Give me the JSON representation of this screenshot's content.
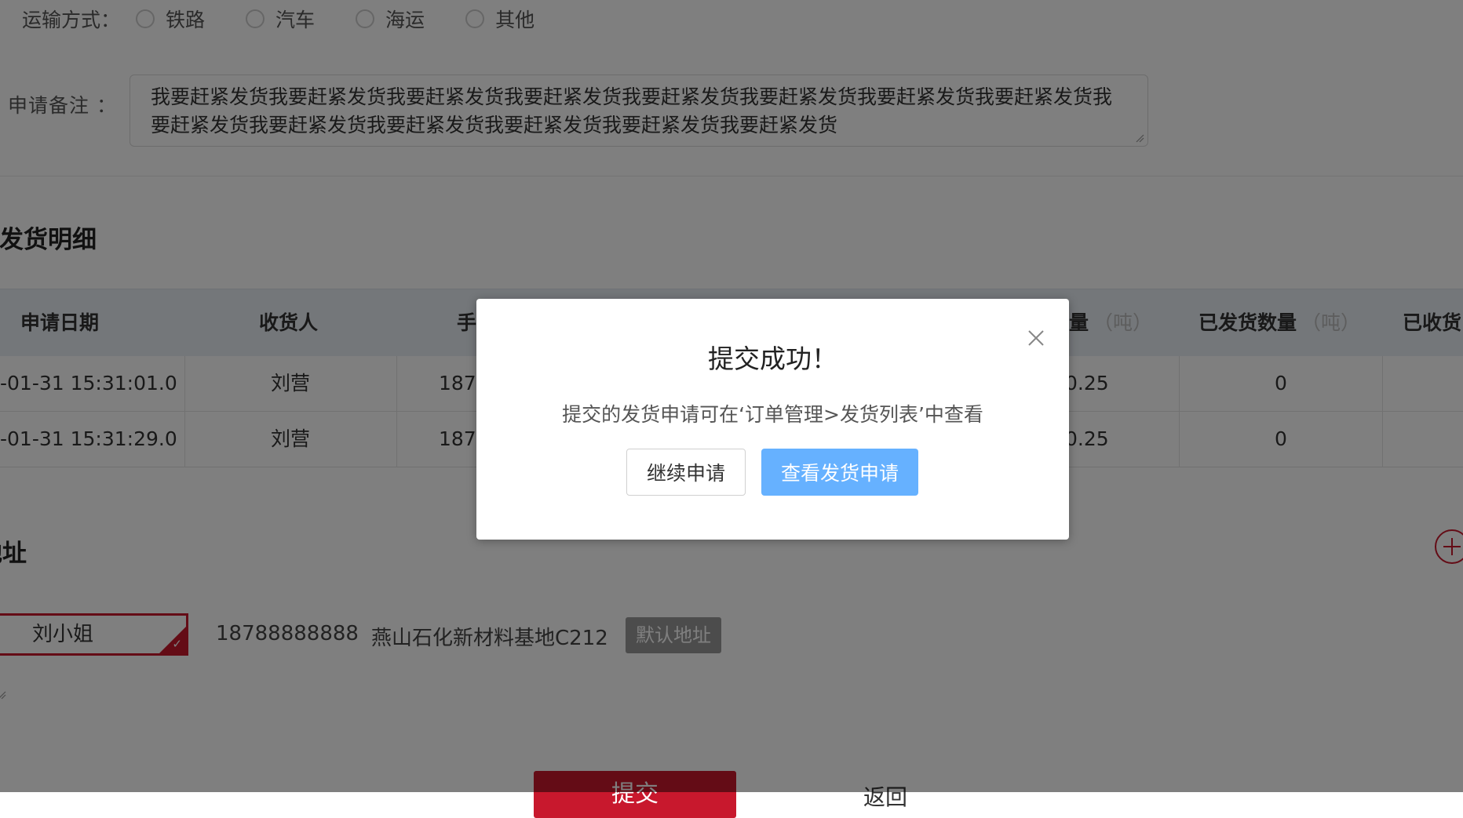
{
  "form": {
    "transport_label": "运输方式：",
    "transport_options": [
      "铁路",
      "汽车",
      "海运",
      "其他"
    ],
    "remark_label": "申请备注 ：",
    "remark_value": "我要赶紧发货我要赶紧发货我要赶紧发货我要赶紧发货我要赶紧发货我要赶紧发货我要赶紧发货我要赶紧发货我要赶紧发货我要赶紧发货我要赶紧发货我要赶紧发货我要赶紧发货我要赶紧发货"
  },
  "detail_section": {
    "title": "请发货明细",
    "headers": {
      "date": "申请日期",
      "receiver": "收货人",
      "phone": "手",
      "qty": "量",
      "qty_unit": "（吨）",
      "shipped": "已发货数量",
      "shipped_unit": "（吨）",
      "received": "已收货"
    },
    "rows": [
      {
        "date": "-01-31 15:31:01.0",
        "receiver": "刘营",
        "phone": "1879",
        "qty": "0.25",
        "shipped": "0"
      },
      {
        "date": "-01-31 15:31:29.0",
        "receiver": "刘营",
        "phone": "1879",
        "qty": "0.25",
        "shipped": "0"
      }
    ]
  },
  "address_section": {
    "title": "地址",
    "name": "刘小姐",
    "phone": "18788888888",
    "detail": "燕山石化新材料基地C212",
    "default_badge": "默认地址"
  },
  "actions": {
    "submit": "提交",
    "back": "返回"
  },
  "modal": {
    "title": "提交成功！",
    "message": "提交的发货申请可在‘订单管理>发货列表’中查看",
    "continue_label": "继续申请",
    "view_label": "查看发货申请"
  },
  "colors": {
    "brand_red": "#c8182d",
    "primary_blue": "#66b1ff",
    "overlay": "rgba(0,0,0,0.5)"
  }
}
